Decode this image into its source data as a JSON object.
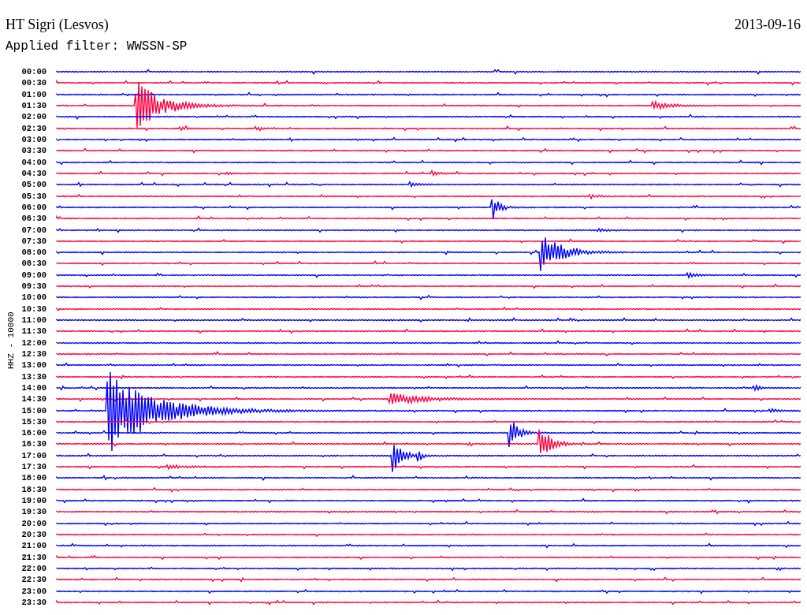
{
  "plot": {
    "station": "HT Sigri (Lesvos)",
    "date": "2013-09-16",
    "filter": "Applied filter: WWSSN-SP",
    "channel_label": "HHZ - 10000",
    "rows": [
      {
        "time": "00:00",
        "color": "#0000ff"
      },
      {
        "time": "00:30",
        "color": "#ff0040"
      },
      {
        "time": "01:00",
        "color": "#0000ff"
      },
      {
        "time": "01:30",
        "color": "#ff0040"
      },
      {
        "time": "02:00",
        "color": "#0000ff"
      },
      {
        "time": "02:30",
        "color": "#ff0040"
      },
      {
        "time": "03:00",
        "color": "#0000ff"
      },
      {
        "time": "03:30",
        "color": "#ff0040"
      },
      {
        "time": "04:00",
        "color": "#0000ff"
      },
      {
        "time": "04:30",
        "color": "#ff0040"
      },
      {
        "time": "05:00",
        "color": "#0000ff"
      },
      {
        "time": "05:30",
        "color": "#ff0040"
      },
      {
        "time": "06:00",
        "color": "#0000ff"
      },
      {
        "time": "06:30",
        "color": "#ff0040"
      },
      {
        "time": "07:00",
        "color": "#0000ff"
      },
      {
        "time": "07:30",
        "color": "#ff0040"
      },
      {
        "time": "08:00",
        "color": "#0000ff"
      },
      {
        "time": "08:30",
        "color": "#ff0040"
      },
      {
        "time": "09:00",
        "color": "#0000ff"
      },
      {
        "time": "09:30",
        "color": "#ff0040"
      },
      {
        "time": "10:00",
        "color": "#0000ff"
      },
      {
        "time": "10:30",
        "color": "#ff0040"
      },
      {
        "time": "11:00",
        "color": "#0000ff"
      },
      {
        "time": "11:30",
        "color": "#ff0040"
      },
      {
        "time": "12:00",
        "color": "#0000ff"
      },
      {
        "time": "12:30",
        "color": "#ff0040"
      },
      {
        "time": "13:00",
        "color": "#0000ff"
      },
      {
        "time": "13:30",
        "color": "#ff0040"
      },
      {
        "time": "14:00",
        "color": "#0000ff"
      },
      {
        "time": "14:30",
        "color": "#ff0040"
      },
      {
        "time": "15:00",
        "color": "#0000ff"
      },
      {
        "time": "15:30",
        "color": "#ff0040"
      },
      {
        "time": "16:00",
        "color": "#0000ff"
      },
      {
        "time": "16:30",
        "color": "#ff0040"
      },
      {
        "time": "17:00",
        "color": "#0000ff"
      },
      {
        "time": "17:30",
        "color": "#ff0040"
      },
      {
        "time": "18:00",
        "color": "#0000ff"
      },
      {
        "time": "18:30",
        "color": "#ff0040"
      },
      {
        "time": "19:00",
        "color": "#0000ff"
      },
      {
        "time": "19:30",
        "color": "#ff0040"
      },
      {
        "time": "20:00",
        "color": "#0000ff"
      },
      {
        "time": "20:30",
        "color": "#ff0040"
      },
      {
        "time": "21:00",
        "color": "#0000ff"
      },
      {
        "time": "21:30",
        "color": "#ff0040"
      },
      {
        "time": "22:00",
        "color": "#0000ff"
      },
      {
        "time": "22:30",
        "color": "#ff0040"
      },
      {
        "time": "23:00",
        "color": "#0000ff"
      },
      {
        "time": "23:30",
        "color": "#ff0040"
      }
    ]
  }
}
